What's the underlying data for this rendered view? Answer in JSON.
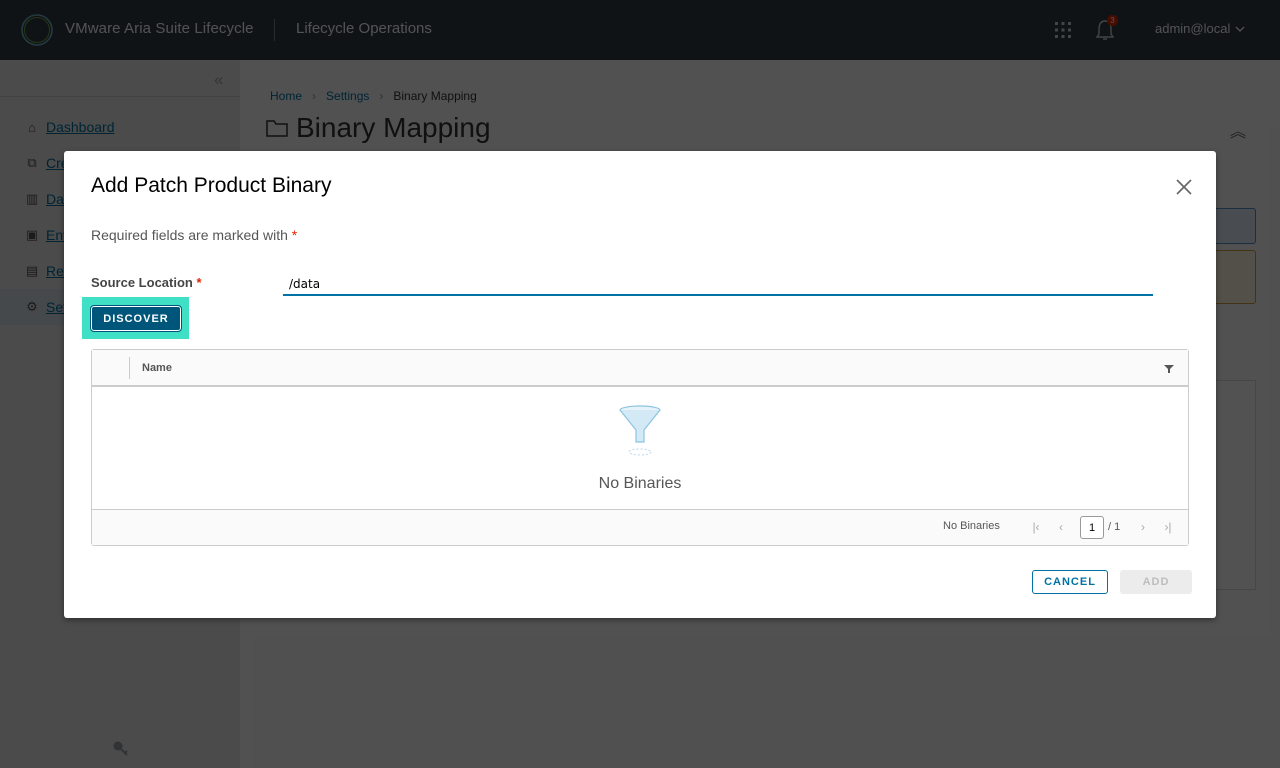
{
  "header": {
    "app_title": "VMware Aria Suite Lifecycle",
    "app_subtitle": "Lifecycle Operations",
    "notification_count": "3",
    "user": "admin@local",
    "icons": {
      "logo": "vmware-ring-logo",
      "apps": "apps-grid-icon",
      "notifications": "bell-icon",
      "user_menu": "chevron-down-icon"
    }
  },
  "sidebar": {
    "collapse_glyph": "«",
    "items": [
      {
        "label": "Dashboard",
        "icon": "home-icon"
      },
      {
        "label": "Create Environment",
        "icon": "create-icon"
      },
      {
        "label": "Datacenters",
        "icon": "datacenter-icon"
      },
      {
        "label": "Environments",
        "icon": "environment-icon"
      },
      {
        "label": "Requests",
        "icon": "requests-icon"
      },
      {
        "label": "Settings",
        "icon": "gear-icon",
        "active": true
      }
    ],
    "bottom_icon": "key-icon"
  },
  "main": {
    "breadcrumb": [
      "Home",
      "Settings",
      "Binary Mapping"
    ],
    "breadcrumb_sep": "›",
    "page_title": "Binary Mapping",
    "collapse_glyph": "︽"
  },
  "modal": {
    "title": "Add Patch Product Binary",
    "required_note": "Required fields are marked with",
    "required_star": "*",
    "source_location_label": "Source Location",
    "source_location_value": "/data",
    "discover_label": "DISCOVER",
    "grid": {
      "columns": [
        "Name"
      ],
      "empty_text": "No Binaries",
      "footer_status": "No Binaries",
      "page_current": "1",
      "page_total": "/ 1",
      "pager_glyphs": {
        "first": "|‹",
        "prev": "‹",
        "next": "›",
        "last": "›|"
      }
    },
    "cancel_label": "CANCEL",
    "add_label": "ADD"
  },
  "colors": {
    "header_bg": "#313c45",
    "primary": "#0072a3",
    "discover_bg": "#00567a",
    "highlight": "#3fe0c5",
    "required": "#e02200"
  }
}
